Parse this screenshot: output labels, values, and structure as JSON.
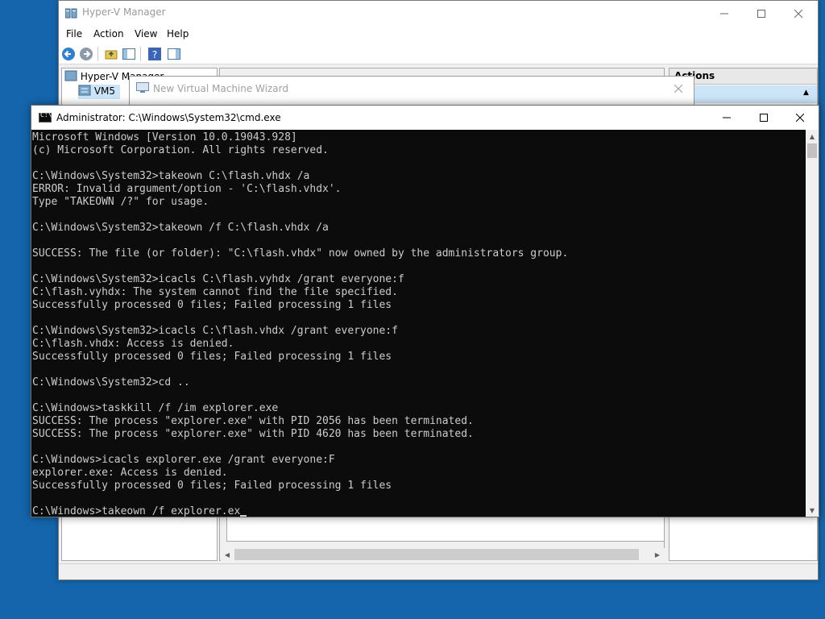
{
  "desktop": {
    "background": "#1565ad"
  },
  "hyperv": {
    "title": "Hyper-V Manager",
    "menu": [
      "File",
      "Action",
      "View",
      "Help"
    ],
    "tree": {
      "root": "Hyper-V Manager",
      "node": "VM5"
    },
    "actions_header": "Actions"
  },
  "wizard": {
    "title": "New Virtual Machine Wizard"
  },
  "cmd": {
    "title": "Administrator: C:\\Windows\\System32\\cmd.exe",
    "lines": [
      "Microsoft Windows [Version 10.0.19043.928]",
      "(c) Microsoft Corporation. All rights reserved.",
      "",
      "C:\\Windows\\System32>takeown C:\\flash.vhdx /a",
      "ERROR: Invalid argument/option - 'C:\\flash.vhdx'.",
      "Type \"TAKEOWN /?\" for usage.",
      "",
      "C:\\Windows\\System32>takeown /f C:\\flash.vhdx /a",
      "",
      "SUCCESS: The file (or folder): \"C:\\flash.vhdx\" now owned by the administrators group.",
      "",
      "C:\\Windows\\System32>icacls C:\\flash.vyhdx /grant everyone:f",
      "C:\\flash.vyhdx: The system cannot find the file specified.",
      "Successfully processed 0 files; Failed processing 1 files",
      "",
      "C:\\Windows\\System32>icacls C:\\flash.vhdx /grant everyone:f",
      "C:\\flash.vhdx: Access is denied.",
      "Successfully processed 0 files; Failed processing 1 files",
      "",
      "C:\\Windows\\System32>cd ..",
      "",
      "C:\\Windows>taskkill /f /im explorer.exe",
      "SUCCESS: The process \"explorer.exe\" with PID 2056 has been terminated.",
      "SUCCESS: The process \"explorer.exe\" with PID 4620 has been terminated.",
      "",
      "C:\\Windows>icacls explorer.exe /grant everyone:F",
      "explorer.exe: Access is denied.",
      "Successfully processed 0 files; Failed processing 1 files",
      "",
      "C:\\Windows>takeown /f explorer.ex"
    ],
    "text_color": "#cccccc",
    "background": "#0c0c0c"
  },
  "icons": {
    "minimize": "minimize-icon",
    "maximize": "maximize-icon",
    "close": "close-icon",
    "back": "back-arrow-icon",
    "forward": "forward-arrow-icon"
  }
}
